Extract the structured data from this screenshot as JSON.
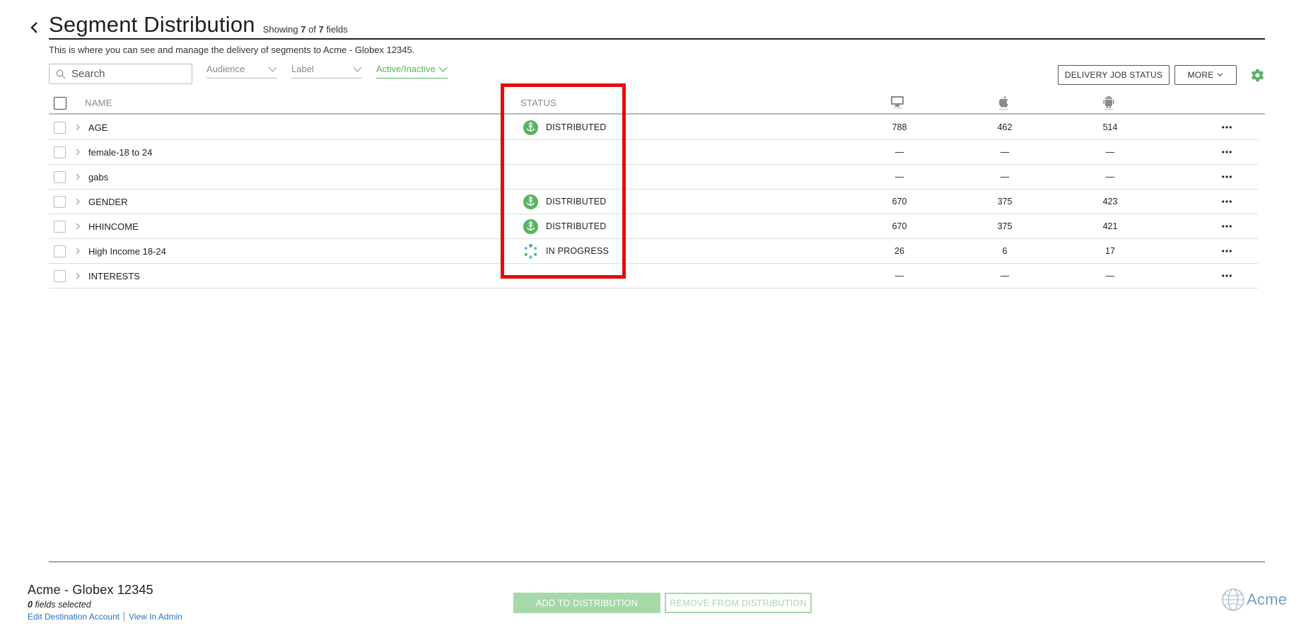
{
  "header": {
    "title": "Segment Distribution",
    "showing_prefix": "Showing",
    "showing_count": "7",
    "showing_of": "of",
    "showing_total": "7",
    "showing_suffix": "fields",
    "subtitle": "This is where you can see and manage the delivery of segments to Acme - Globex 12345."
  },
  "toolbar": {
    "search_placeholder": "Search",
    "filters": [
      {
        "label": "Audience",
        "active": false
      },
      {
        "label": "Label",
        "active": false
      },
      {
        "label": "Active/Inactive",
        "active": true
      }
    ],
    "delivery_job_status_label": "DELIVERY JOB STATUS",
    "more_label": "MORE"
  },
  "table": {
    "columns": {
      "name": "NAME",
      "status": "STATUS",
      "platforms": [
        "desktop-icon",
        "apple-icon",
        "android-icon"
      ]
    },
    "rows": [
      {
        "name": "AGE",
        "status": "DISTRIBUTED",
        "status_kind": "distributed",
        "desktop": "788",
        "ios": "462",
        "android": "514"
      },
      {
        "name": "female-18 to 24",
        "status": "",
        "status_kind": "none",
        "desktop": "—",
        "ios": "—",
        "android": "—"
      },
      {
        "name": "gabs",
        "status": "",
        "status_kind": "none",
        "desktop": "—",
        "ios": "—",
        "android": "—"
      },
      {
        "name": "GENDER",
        "status": "DISTRIBUTED",
        "status_kind": "distributed",
        "desktop": "670",
        "ios": "375",
        "android": "423"
      },
      {
        "name": "HHINCOME",
        "status": "DISTRIBUTED",
        "status_kind": "distributed",
        "desktop": "670",
        "ios": "375",
        "android": "421"
      },
      {
        "name": "High Income 18-24",
        "status": "IN PROGRESS",
        "status_kind": "in-progress",
        "desktop": "26",
        "ios": "6",
        "android": "17"
      },
      {
        "name": "INTERESTS",
        "status": "",
        "status_kind": "none",
        "desktop": "—",
        "ios": "—",
        "android": "—"
      }
    ]
  },
  "footer": {
    "account_name": "Acme - Globex 12345",
    "selected_count": "0",
    "selected_suffix": "fields selected",
    "edit_link": "Edit Destination Account",
    "admin_link": "View In Admin",
    "add_label": "ADD TO DISTRIBUTION",
    "remove_label": "REMOVE FROM DISTRIBUTION",
    "logo_text": "Acme"
  },
  "colors": {
    "accent_green": "#59b45e",
    "disabled_green": "#a6d8a8",
    "link_blue": "#2a73c6",
    "highlight_red": "#e8090c"
  }
}
